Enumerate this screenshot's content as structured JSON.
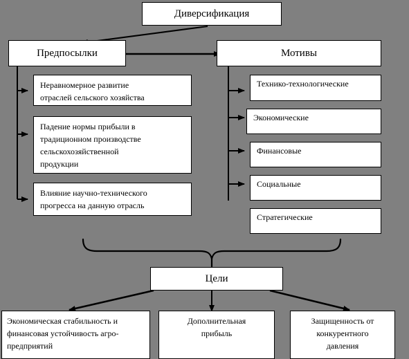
{
  "diagram": {
    "title_box": {
      "label": "Диверсификация"
    },
    "background_color": "#808080",
    "box_fill_color": "#ffffff",
    "line_color": "#000000",
    "branches": [
      {
        "label": "Предпосылки"
      },
      {
        "label": "Мотивы"
      }
    ],
    "preconditions": [
      {
        "label": "Неравномерное развитие\nотраслей сельского хозяйства"
      },
      {
        "label": "Падение нормы прибыли  в\nтрадиционном  производстве\nсельскохозяйственной\nпродукции"
      },
      {
        "label": "Влияние  научно-технического\nпрогресса на данную отрасль"
      }
    ],
    "motives": [
      {
        "label": "Технико-технологические"
      },
      {
        "label": "Экономические"
      },
      {
        "label": "Финансовые"
      },
      {
        "label": "Социальные"
      },
      {
        "label": "Стратегические"
      }
    ],
    "goals_box": {
      "label": "Цели"
    },
    "goals": [
      {
        "label": "Экономическая стабильность и\nфинансовая устойчивость агро-\nпредприятий"
      },
      {
        "label": "Дополнительная\nприбыль"
      },
      {
        "label": "Защищенность от\nконкурентного\nдавления"
      }
    ]
  }
}
